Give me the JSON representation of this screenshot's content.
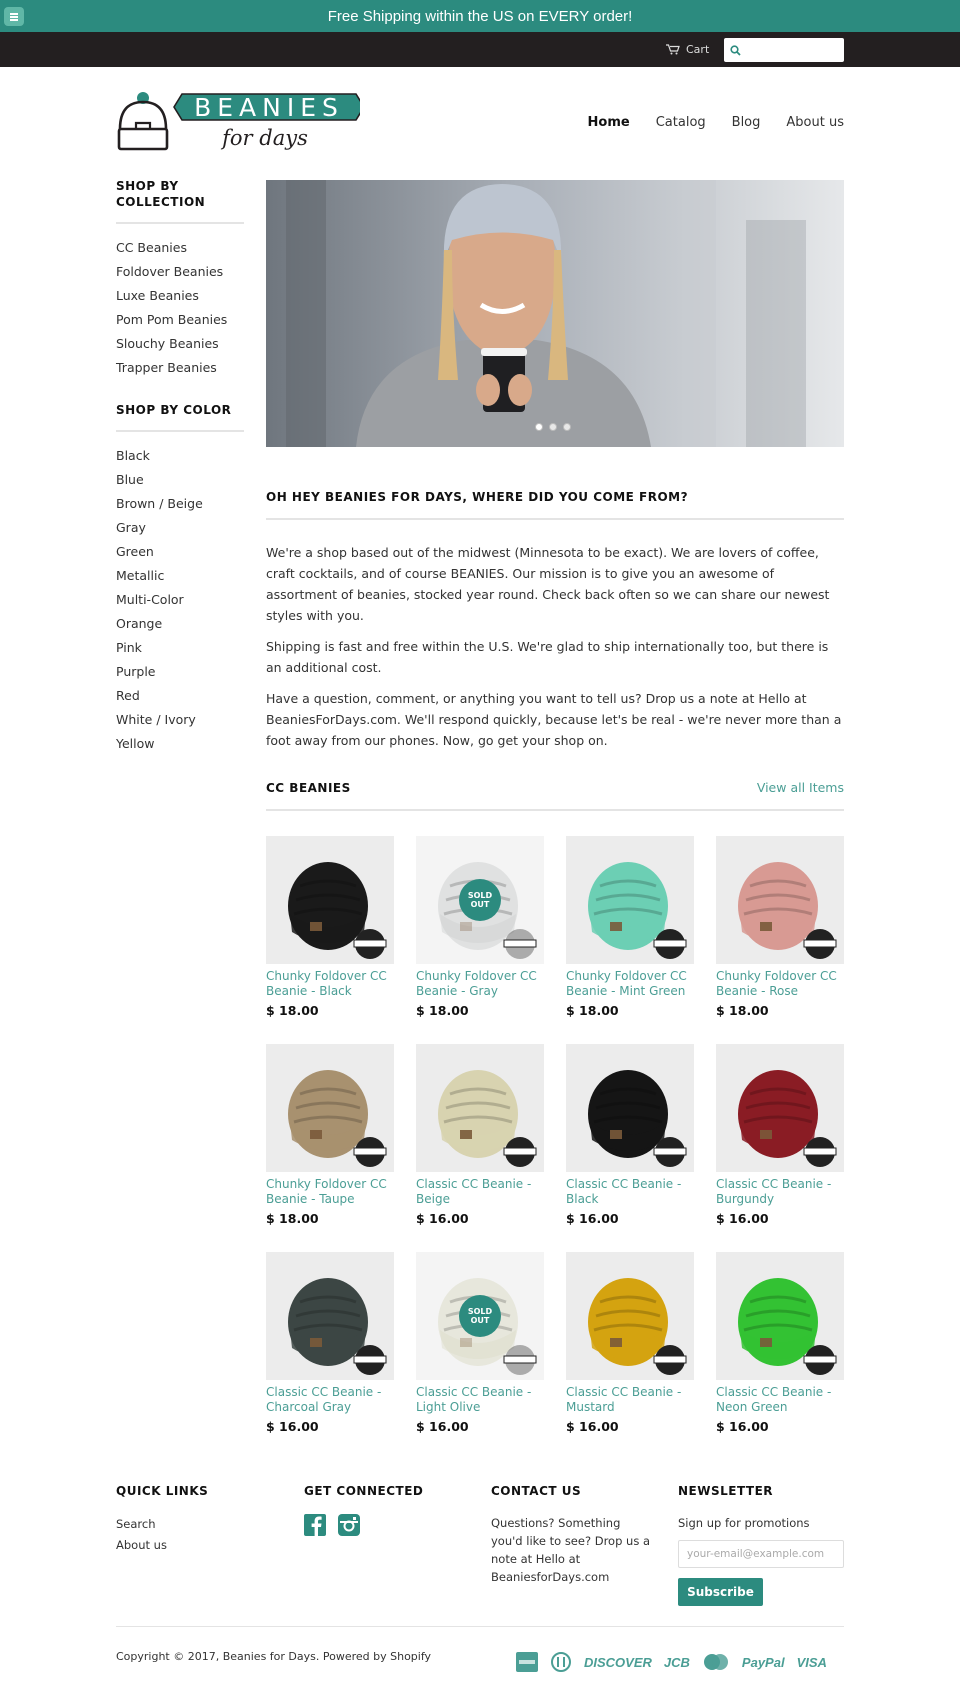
{
  "announcement": "Free Shipping within the US on EVERY order!",
  "topbar": {
    "cart_label": "Cart",
    "search_placeholder": ""
  },
  "brand": {
    "logo_top": "BEANIES",
    "logo_bottom": "for days"
  },
  "nav": [
    {
      "label": "Home",
      "active": true
    },
    {
      "label": "Catalog"
    },
    {
      "label": "Blog"
    },
    {
      "label": "About us"
    }
  ],
  "sidebar": {
    "collection_heading": "SHOP BY COLLECTION",
    "collections": [
      "CC Beanies",
      "Foldover Beanies",
      "Luxe Beanies",
      "Pom Pom Beanies",
      "Slouchy Beanies",
      "Trapper Beanies"
    ],
    "color_heading": "SHOP BY COLOR",
    "colors": [
      "Black",
      "Blue",
      "Brown / Beige",
      "Gray",
      "Green",
      "Metallic",
      "Multi-Color",
      "Orange",
      "Pink",
      "Purple",
      "Red",
      "White / Ivory",
      "Yellow"
    ]
  },
  "about": {
    "heading": "OH HEY BEANIES FOR DAYS, WHERE DID YOU COME FROM?",
    "p1": "We're a shop based out of the midwest (Minnesota to be exact). We are lovers of coffee, craft cocktails, and of course BEANIES. Our mission is to give you an awesome of assortment of beanies, stocked year round. Check back often so we can share our newest styles with you.",
    "p2": "Shipping is fast and free within the U.S. We're glad to ship internationally too, but there is an additional cost.",
    "p3": "Have a question, comment, or anything you want to tell us? Drop us a note at Hello at BeaniesForDays.com. We'll respond quickly, because let's be real - we're never more than a foot away from our phones. Now, go get your shop on."
  },
  "collection": {
    "heading": "CC BEANIES",
    "view_all": "View all Items",
    "sold_out_label": "SOLD OUT",
    "products": [
      {
        "title": "Chunky Foldover CC Beanie - Black",
        "price": "$ 18.00",
        "color": "#1a1a1a",
        "sold_out": false
      },
      {
        "title": "Chunky Foldover CC Beanie - Gray",
        "price": "$ 18.00",
        "color": "#cfd1d1",
        "sold_out": true
      },
      {
        "title": "Chunky Foldover CC Beanie - Mint Green",
        "price": "$ 18.00",
        "color": "#6ccfb4",
        "sold_out": false
      },
      {
        "title": "Chunky Foldover CC Beanie - Rose",
        "price": "$ 18.00",
        "color": "#d89a93",
        "sold_out": false
      },
      {
        "title": "Chunky Foldover CC Beanie - Taupe",
        "price": "$ 18.00",
        "color": "#a8916f",
        "sold_out": false
      },
      {
        "title": "Classic CC Beanie - Beige",
        "price": "$ 16.00",
        "color": "#d8d3b0",
        "sold_out": false
      },
      {
        "title": "Classic CC Beanie - Black",
        "price": "$ 16.00",
        "color": "#151515",
        "sold_out": false
      },
      {
        "title": "Classic CC Beanie - Burgundy",
        "price": "$ 16.00",
        "color": "#8a1c24",
        "sold_out": false
      },
      {
        "title": "Classic CC Beanie - Charcoal Gray",
        "price": "$ 16.00",
        "color": "#3c4644",
        "sold_out": false
      },
      {
        "title": "Classic CC Beanie - Light Olive",
        "price": "$ 16.00",
        "color": "#dcdcc8",
        "sold_out": true
      },
      {
        "title": "Classic CC Beanie - Mustard",
        "price": "$ 16.00",
        "color": "#d4a310",
        "sold_out": false
      },
      {
        "title": "Classic CC Beanie - Neon Green",
        "price": "$ 16.00",
        "color": "#33c233",
        "sold_out": false
      }
    ]
  },
  "footer": {
    "quick_links_heading": "QUICK LINKS",
    "quick_links": [
      "Search",
      "About us"
    ],
    "connected_heading": "GET CONNECTED",
    "contact_heading": "CONTACT US",
    "contact_text": "Questions? Something you'd like to see? Drop us a note at Hello at BeaniesforDays.com",
    "newsletter_heading": "NEWSLETTER",
    "newsletter_text": "Sign up for promotions",
    "email_placeholder": "your-email@example.com",
    "subscribe_label": "Subscribe",
    "copyright": "Copyright © 2017, Beanies for Days. Powered by Shopify",
    "payments": [
      "DISCOVER",
      "JCB",
      "PayPal",
      "VISA"
    ]
  },
  "colors": {
    "accent": "#2c8b7f",
    "link": "#4b9e95",
    "topbar": "#231f20"
  }
}
